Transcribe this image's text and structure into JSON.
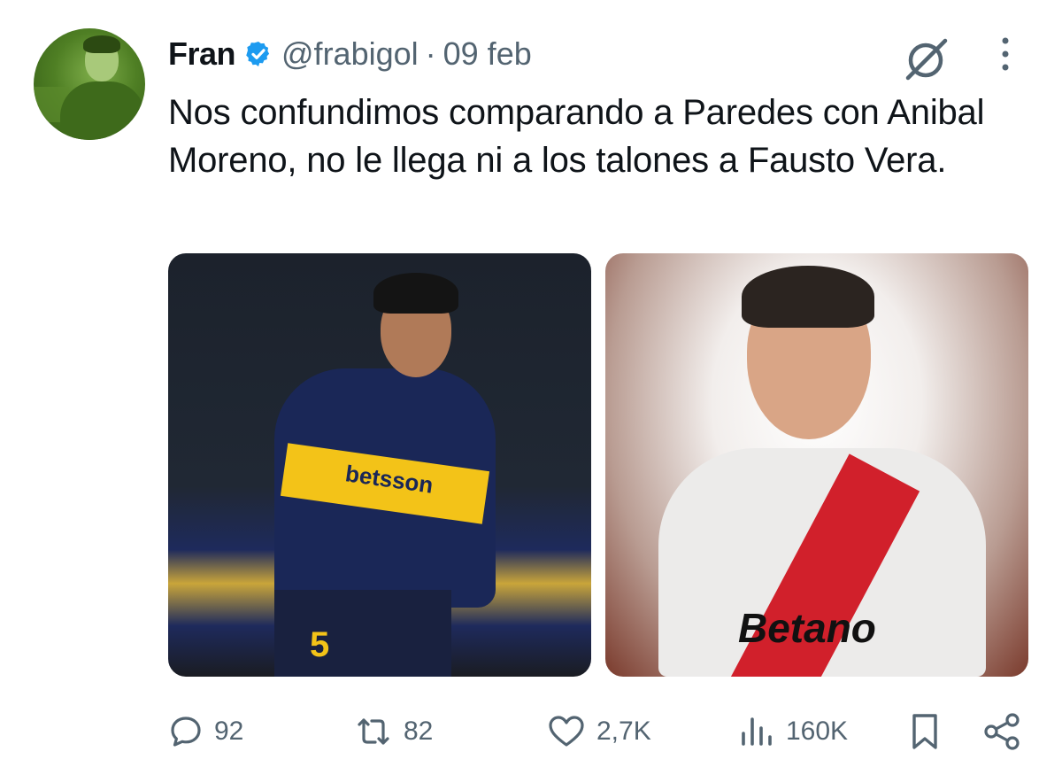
{
  "tweet": {
    "author_name": "Fran",
    "handle": "@frabigol",
    "separator": "·",
    "date": "09 feb",
    "text": "Nos confundimos comparando a Paredes con Anibal Moreno, no le llega ni a los talones a Fausto Vera.",
    "verified": true,
    "media": [
      {
        "label": "betsson",
        "number": "5"
      },
      {
        "label": "Betano"
      }
    ]
  },
  "actions": {
    "replies": "92",
    "reposts": "82",
    "likes": "2,7K",
    "views": "160K"
  },
  "icons": {
    "verified": "verified-badge-icon",
    "grok": "grok-icon",
    "more": "more-options-icon",
    "reply": "reply-icon",
    "repost": "repost-icon",
    "like": "like-icon",
    "views": "views-icon",
    "bookmark": "bookmark-icon",
    "share": "share-icon"
  },
  "colors": {
    "text": "#0f1419",
    "secondary": "#536471",
    "verified": "#1d9bf0"
  }
}
